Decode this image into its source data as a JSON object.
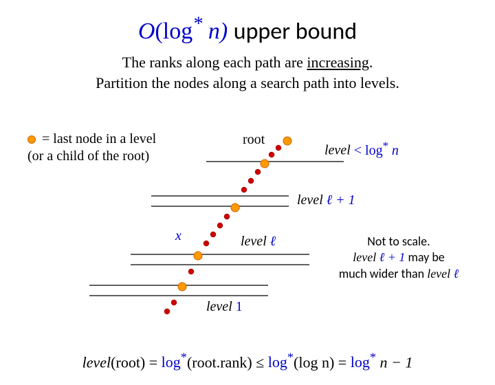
{
  "title": {
    "math_prefix": "O",
    "math_mid": "(log",
    "math_star": "*",
    "math_arg": " n)",
    "rest": " upper bound"
  },
  "subtitle_l1a": "The ranks along each path are ",
  "subtitle_l1b": "increasing",
  "subtitle_l1c": ".",
  "subtitle_l2": "Partition the nodes along a search path into levels.",
  "legend_l1": " = last node in a level",
  "legend_l2": "(or a child of the root)",
  "labels": {
    "root": "root",
    "level_lt_a": "level",
    "level_lt_b": " < log",
    "level_lt_c": "*",
    "level_lt_d": " n",
    "level_lp1_a": "level",
    "level_lp1_b": " ℓ + 1",
    "x": "x",
    "level_l_a": "level",
    "level_l_b": " ℓ",
    "level_1_a": "level",
    "level_1_b": " 1"
  },
  "note": {
    "l1": "Not to scale.",
    "l2a": "level",
    "l2b": " ℓ + 1",
    "l2c": " may be",
    "l3a": "much wider than ",
    "l3b": "level",
    "l3c": " ℓ"
  },
  "bottom": {
    "a": "level",
    "b": "(root) = ",
    "c": "log",
    "d": "*",
    "e": "(root.rank) ≤ ",
    "f": "log",
    "g": "*",
    "h": "(log n) = ",
    "i": "log",
    "j": "*",
    "k": " n − 1"
  }
}
